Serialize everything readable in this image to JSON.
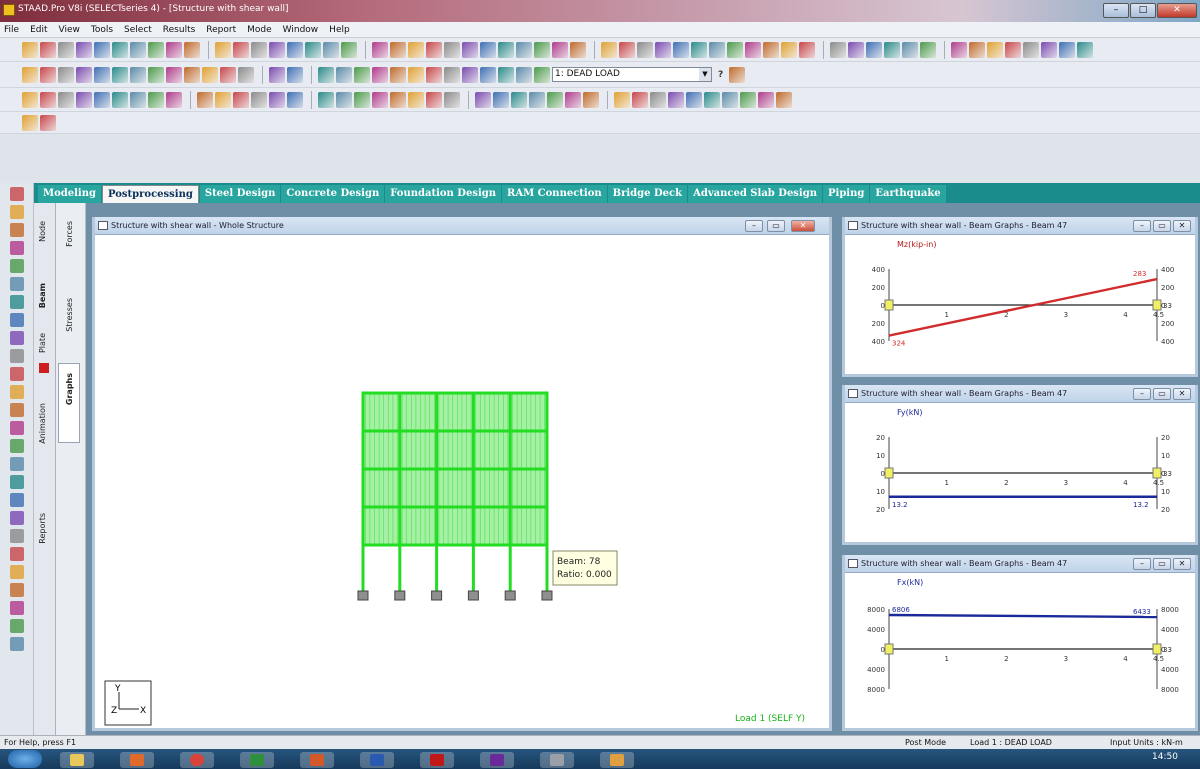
{
  "window": {
    "title": "STAAD.Pro V8i (SELECTseries 4) - [Structure with shear wall]",
    "min": "–",
    "max": "□",
    "close": "✕"
  },
  "menu": [
    "File",
    "Edit",
    "View",
    "Tools",
    "Select",
    "Results",
    "Report",
    "Mode",
    "Window",
    "Help"
  ],
  "toolbar": {
    "load_combo": "1: DEAD LOAD",
    "help": "?"
  },
  "page_tabs": [
    {
      "label": "Modeling",
      "active": false
    },
    {
      "label": "Postprocessing",
      "active": true
    },
    {
      "label": "Steel Design",
      "active": false
    },
    {
      "label": "Concrete Design",
      "active": false
    },
    {
      "label": "Foundation Design",
      "active": false
    },
    {
      "label": "RAM Connection",
      "active": false
    },
    {
      "label": "Bridge Deck",
      "active": false
    },
    {
      "label": "Advanced Slab Design",
      "active": false
    },
    {
      "label": "Piping",
      "active": false
    },
    {
      "label": "Earthquake",
      "active": false
    }
  ],
  "side_tabs": {
    "node": "Node",
    "beam": "Beam",
    "plate": "Plate",
    "animation": "Animation",
    "reports": "Reports",
    "forces": "Forces",
    "stresses": "Stresses",
    "graphs": "Graphs"
  },
  "main_window": {
    "title": "Structure with shear wall - Whole Structure",
    "tooltip_beam": "Beam: 78",
    "tooltip_ratio": "Ratio: 0.000",
    "load_label": "Load 1 (SELF Y)",
    "axis_y": "Y",
    "axis_z": "Z",
    "axis_x": "X"
  },
  "graph1": {
    "title": "Structure with shear wall - Beam Graphs - Beam 47",
    "label": "Mz(kip-in)",
    "left_ticks": [
      "400",
      "200",
      "0",
      "200",
      "400"
    ],
    "right_ticks": [
      "400",
      "200",
      "0",
      "200",
      "400"
    ],
    "x_ticks": [
      "1",
      "2",
      "3",
      "4",
      "4.5"
    ],
    "val_start": "324",
    "val_end": "283",
    "ref": "33",
    "line_color": "#d22b2b"
  },
  "graph2": {
    "title": "Structure with shear wall - Beam Graphs - Beam 47",
    "label": "Fy(kN)",
    "left_ticks": [
      "20",
      "10",
      "0",
      "10",
      "20"
    ],
    "right_ticks": [
      "20",
      "10",
      "0",
      "10",
      "20"
    ],
    "x_ticks": [
      "1",
      "2",
      "3",
      "4",
      "4.5"
    ],
    "val_start": "13.2",
    "val_end": "13.2",
    "ref": "33",
    "line_color": "#1b2a9a"
  },
  "graph3": {
    "title": "Structure with shear wall - Beam Graphs - Beam 47",
    "label": "Fx(kN)",
    "left_ticks": [
      "8000",
      "4000",
      "0",
      "4000",
      "8000"
    ],
    "right_ticks": [
      "8000",
      "4000",
      "0",
      "4000",
      "8000"
    ],
    "x_ticks": [
      "1",
      "2",
      "3",
      "4",
      "4.5"
    ],
    "val_start": "6806",
    "val_end": "6433",
    "ref": "33",
    "line_color": "#1b2a9a"
  },
  "status": {
    "help": "For Help, press F1",
    "mode": "Post Mode",
    "load": "Load 1 : DEAD LOAD",
    "units": "Input Units : kN-m"
  },
  "taskbar": {
    "time": "14:50"
  },
  "colors": {
    "frame": "#22dd22",
    "fill": "#a6f0a6",
    "tabstrip": "#1b8c8c"
  }
}
